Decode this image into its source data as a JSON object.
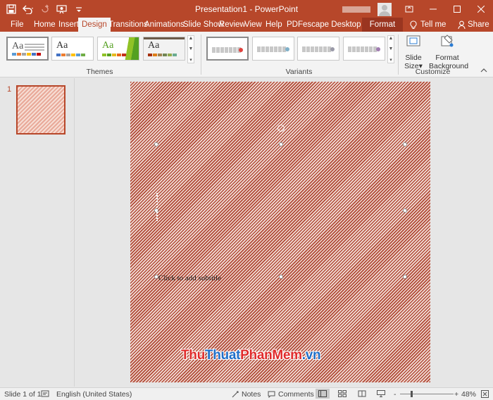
{
  "window": {
    "title": "Presentation1  -  PowerPoint",
    "accent": "#b7472a"
  },
  "quick_access": [
    "save-icon",
    "undo-icon",
    "redo-icon",
    "start-from-beginning-icon",
    "customize-icon"
  ],
  "tabs": [
    {
      "label": "File"
    },
    {
      "label": "Home"
    },
    {
      "label": "Insert"
    },
    {
      "label": "Design"
    },
    {
      "label": "Transitions"
    },
    {
      "label": "Animations"
    },
    {
      "label": "Slide Show"
    },
    {
      "label": "Review"
    },
    {
      "label": "View"
    },
    {
      "label": "Help"
    },
    {
      "label": "PDFescape Desktop Creator"
    },
    {
      "label": "Format"
    }
  ],
  "active_tab": "Design",
  "tell_me": "Tell me",
  "share": "Share",
  "ribbon": {
    "themes_label": "Themes",
    "variants_label": "Variants",
    "customize_label": "Customize",
    "themes": [
      {
        "aa": "Aa",
        "bg": "#ffffff",
        "text": "#555555",
        "bars": [
          "#5b9bd5",
          "#ed7d31",
          "#a5a5a5",
          "#ffc000",
          "#4472c4",
          "#70ad47"
        ],
        "selected": true
      },
      {
        "aa": "Aa",
        "bg": "#ffffff",
        "text": "#333333",
        "bars": [
          "#4472c4",
          "#ed7d31",
          "#a5a5a5",
          "#ffc000",
          "#5b9bd5",
          "#70ad47"
        ],
        "selected": false
      },
      {
        "aa": "Aa",
        "bg": "#ffffff",
        "text": "#ffffff",
        "bars": [
          "#90c226",
          "#54a021",
          "#e6b91e",
          "#e76618",
          "#c42f1a",
          "#918655"
        ],
        "selected": false
      },
      {
        "aa": "Aa",
        "bg": "#f2f2f2",
        "text": "#333333",
        "bars": [
          "#a53010",
          "#de7e18",
          "#9f8351",
          "#728653",
          "#92aa4c",
          "#6aac91"
        ],
        "selected": false
      }
    ],
    "variants": [
      {
        "selected": true,
        "dot": "#e0413c"
      },
      {
        "selected": false,
        "dot": "#7fb0c9"
      },
      {
        "selected": false,
        "dot": "#9a9aa8"
      },
      {
        "selected": false,
        "dot": "#a07cb0"
      }
    ],
    "slide_size": [
      "Slide",
      "Size"
    ],
    "format_background": [
      "Format",
      "Background"
    ]
  },
  "slides_pane": {
    "number": "1"
  },
  "slide": {
    "subtitle_placeholder": "Click to add subtitle",
    "watermark": {
      "part1": "Thu",
      "part2": "Thuat",
      "part3": "PhanMem",
      "part4": ".vn"
    }
  },
  "status": {
    "slide_info": "Slide 1 of 1",
    "language": "English (United States)",
    "notes": "Notes",
    "comments": "Comments",
    "zoom": "48%",
    "zoom_minus": "-",
    "zoom_plus": "+"
  }
}
